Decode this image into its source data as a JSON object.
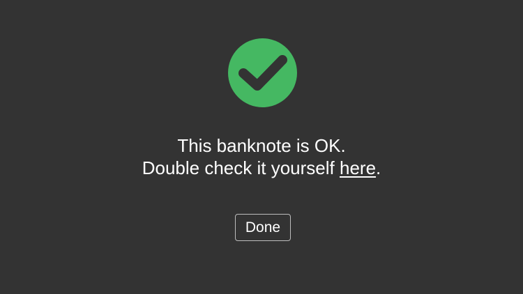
{
  "result": {
    "icon": "checkmark-circle-icon",
    "status_color": "#45b862",
    "message_line_1": "This banknote is OK.",
    "message_line_2_prefix": "Double check it yourself ",
    "link_text": "here",
    "message_line_2_suffix": "."
  },
  "actions": {
    "done_label": "Done"
  },
  "colors": {
    "background": "#333333",
    "text": "#ffffff",
    "button_border": "#bdbdbd"
  }
}
